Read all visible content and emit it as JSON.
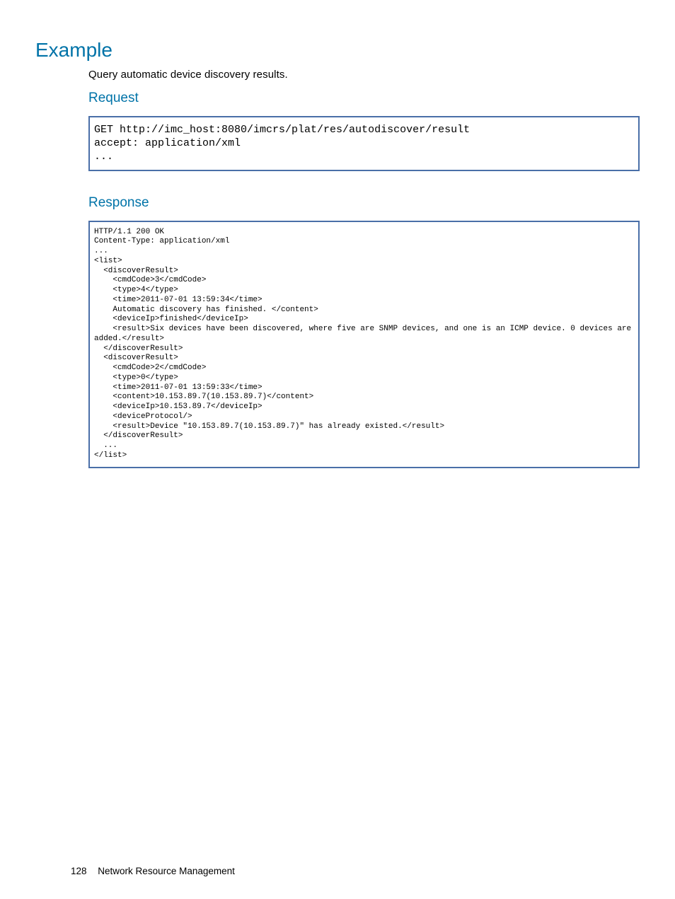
{
  "headings": {
    "example": "Example",
    "request": "Request",
    "response": "Response"
  },
  "description": "Query automatic device discovery results.",
  "request_code": "GET http://imc_host:8080/imcrs/plat/res/autodiscover/result\naccept: application/xml\n...",
  "response_code": "HTTP/1.1 200 OK\nContent-Type: application/xml\n...\n<list>\n  <discoverResult>\n    <cmdCode>3</cmdCode>\n    <type>4</type>\n    <time>2011-07-01 13:59:34</time>\n    Automatic discovery has finished. </content>\n    <deviceIp>finished</deviceIp>\n    <result>Six devices have been discovered, where five are SNMP devices, and one is an ICMP device. 0 devices are\nadded.</result>\n  </discoverResult>\n  <discoverResult>\n    <cmdCode>2</cmdCode>\n    <type>0</type>\n    <time>2011-07-01 13:59:33</time>\n    <content>10.153.89.7(10.153.89.7)</content>\n    <deviceIp>10.153.89.7</deviceIp>\n    <deviceProtocol/>\n    <result>Device \"10.153.89.7(10.153.89.7)\" has already existed.</result>\n  </discoverResult>\n  ...\n</list>",
  "footer": {
    "page_number": "128",
    "section": "Network Resource Management"
  }
}
